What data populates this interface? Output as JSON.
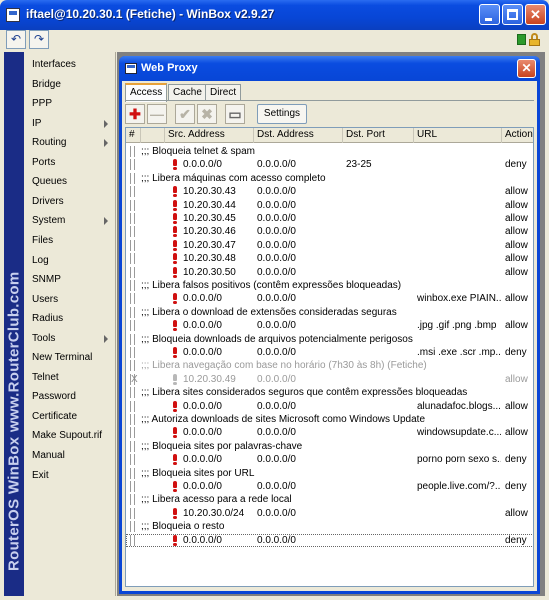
{
  "window": {
    "title": "iftael@10.20.30.1 (Fetiche) - WinBox v2.9.27",
    "minimize_label": "",
    "maximize_label": "",
    "close_label": "✕"
  },
  "toolbar": {
    "undo_icon": "undo-icon",
    "redo_icon": "redo-icon",
    "status_color": "#2c9a2c"
  },
  "brand": {
    "text": "RouterOS WinBox  www.RouterClub.com"
  },
  "menu": {
    "items": [
      {
        "label": "Interfaces",
        "submenu": false
      },
      {
        "label": "Bridge",
        "submenu": false
      },
      {
        "label": "PPP",
        "submenu": false
      },
      {
        "label": "IP",
        "submenu": true
      },
      {
        "label": "Routing",
        "submenu": true
      },
      {
        "label": "Ports",
        "submenu": false
      },
      {
        "label": "Queues",
        "submenu": false
      },
      {
        "label": "Drivers",
        "submenu": false
      },
      {
        "label": "System",
        "submenu": true
      },
      {
        "label": "Files",
        "submenu": false
      },
      {
        "label": "Log",
        "submenu": false
      },
      {
        "label": "SNMP",
        "submenu": false
      },
      {
        "label": "Users",
        "submenu": false
      },
      {
        "label": "Radius",
        "submenu": false
      },
      {
        "label": "Tools",
        "submenu": true
      },
      {
        "label": "New Terminal",
        "submenu": false
      },
      {
        "label": "Telnet",
        "submenu": false
      },
      {
        "label": "Password",
        "submenu": false
      },
      {
        "label": "Certificate",
        "submenu": false
      },
      {
        "label": "Make Supout.rif",
        "submenu": false
      },
      {
        "label": "Manual",
        "submenu": false
      },
      {
        "label": "Exit",
        "submenu": false
      }
    ]
  },
  "proxy": {
    "title": "Web Proxy",
    "close_label": "✕",
    "tabs": [
      {
        "label": "Access",
        "active": true
      },
      {
        "label": "Cache",
        "active": false
      },
      {
        "label": "Direct",
        "active": false
      }
    ],
    "buttons": {
      "add": "✚",
      "remove": "—",
      "enable": "✔",
      "disable": "✖",
      "comment": "▭",
      "settings": "Settings"
    },
    "columns": [
      "#",
      "Src. Address",
      "Dst. Address",
      "Dst. Port",
      "URL",
      "Action"
    ],
    "rows": [
      {
        "type": "comment",
        "text": ";;; Bloqueia telnet & spam",
        "disabled": false
      },
      {
        "type": "rule",
        "src": "0.0.0.0/0",
        "dst": "0.0.0.0/0",
        "port": "23-25",
        "url": "",
        "action": "deny",
        "disabled": false
      },
      {
        "type": "comment",
        "text": ";;; Libera máquinas com acesso completo",
        "disabled": false
      },
      {
        "type": "rule",
        "src": "10.20.30.43",
        "dst": "0.0.0.0/0",
        "port": "",
        "url": "",
        "action": "allow",
        "disabled": false
      },
      {
        "type": "rule",
        "src": "10.20.30.44",
        "dst": "0.0.0.0/0",
        "port": "",
        "url": "",
        "action": "allow",
        "disabled": false
      },
      {
        "type": "rule",
        "src": "10.20.30.45",
        "dst": "0.0.0.0/0",
        "port": "",
        "url": "",
        "action": "allow",
        "disabled": false
      },
      {
        "type": "rule",
        "src": "10.20.30.46",
        "dst": "0.0.0.0/0",
        "port": "",
        "url": "",
        "action": "allow",
        "disabled": false
      },
      {
        "type": "rule",
        "src": "10.20.30.47",
        "dst": "0.0.0.0/0",
        "port": "",
        "url": "",
        "action": "allow",
        "disabled": false
      },
      {
        "type": "rule",
        "src": "10.20.30.48",
        "dst": "0.0.0.0/0",
        "port": "",
        "url": "",
        "action": "allow",
        "disabled": false
      },
      {
        "type": "rule",
        "src": "10.20.30.50",
        "dst": "0.0.0.0/0",
        "port": "",
        "url": "",
        "action": "allow",
        "disabled": false
      },
      {
        "type": "comment",
        "text": ";;; Libera falsos positivos (contêm expressões bloqueadas)",
        "disabled": false
      },
      {
        "type": "rule",
        "src": "0.0.0.0/0",
        "dst": "0.0.0.0/0",
        "port": "",
        "url": "winbox.exe PIAIN...",
        "action": "allow",
        "disabled": false
      },
      {
        "type": "comment",
        "text": ";;; Libera o download de extensões consideradas seguras",
        "disabled": false
      },
      {
        "type": "rule",
        "src": "0.0.0.0/0",
        "dst": "0.0.0.0/0",
        "port": "",
        "url": ".jpg .gif .png .bmp",
        "action": "allow",
        "disabled": false
      },
      {
        "type": "comment",
        "text": ";;; Bloqueia downloads de arquivos potencialmente perigosos",
        "disabled": false
      },
      {
        "type": "rule",
        "src": "0.0.0.0/0",
        "dst": "0.0.0.0/0",
        "port": "",
        "url": ".msi .exe .scr .mp...",
        "action": "deny",
        "disabled": false
      },
      {
        "type": "comment",
        "text": ";;; Libera navegação com base no horário (7h30 às 8h) (Fetiche)",
        "disabled": true
      },
      {
        "type": "rule",
        "src": "10.20.30.49",
        "dst": "0.0.0.0/0",
        "port": "",
        "url": "",
        "action": "allow",
        "disabled": true,
        "x": true
      },
      {
        "type": "comment",
        "text": ";;; Libera sites considerados seguros que contêm expressões bloqueadas",
        "disabled": false
      },
      {
        "type": "rule",
        "src": "0.0.0.0/0",
        "dst": "0.0.0.0/0",
        "port": "",
        "url": "alunadafoc.blogs...",
        "action": "allow",
        "disabled": false
      },
      {
        "type": "comment",
        "text": ";;; Autoriza downloads de sites Microsoft como Windows Update",
        "disabled": false
      },
      {
        "type": "rule",
        "src": "0.0.0.0/0",
        "dst": "0.0.0.0/0",
        "port": "",
        "url": "windowsupdate.c...",
        "action": "allow",
        "disabled": false
      },
      {
        "type": "comment",
        "text": ";;; Bloqueia sites por palavras-chave",
        "disabled": false
      },
      {
        "type": "rule",
        "src": "0.0.0.0/0",
        "dst": "0.0.0.0/0",
        "port": "",
        "url": "porno porn sexo s...",
        "action": "deny",
        "disabled": false
      },
      {
        "type": "comment",
        "text": ";;; Bloqueia sites por URL",
        "disabled": false
      },
      {
        "type": "rule",
        "src": "0.0.0.0/0",
        "dst": "0.0.0.0/0",
        "port": "",
        "url": "people.live.com/?...",
        "action": "deny",
        "disabled": false
      },
      {
        "type": "comment",
        "text": ";;; Libera acesso para a rede local",
        "disabled": false
      },
      {
        "type": "rule",
        "src": "10.20.30.0/24",
        "dst": "0.0.0.0/0",
        "port": "",
        "url": "",
        "action": "allow",
        "disabled": false
      },
      {
        "type": "comment",
        "text": ";;; Bloqueia o resto",
        "disabled": false
      },
      {
        "type": "rule",
        "src": "0.0.0.0/0",
        "dst": "0.0.0.0/0",
        "port": "",
        "url": "",
        "action": "deny",
        "disabled": false,
        "selected": true
      }
    ]
  }
}
